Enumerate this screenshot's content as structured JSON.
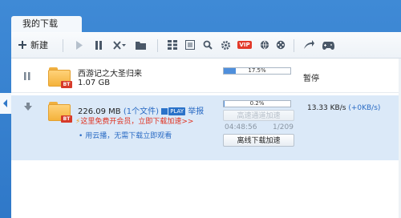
{
  "window": {
    "tab_title": "我的下载"
  },
  "toolbar": {
    "new_label": "新建",
    "vip_label": "VIP",
    "icons": [
      "plus-icon",
      "play-icon",
      "pause-icon",
      "delete-icon",
      "folder-icon",
      "list-view-icon",
      "details-icon",
      "search-icon",
      "gear-icon",
      "vip-icon",
      "globe-icon",
      "film-reel-icon",
      "share-icon",
      "gamepad-icon"
    ]
  },
  "colors": {
    "accent": "#2f78c8",
    "promo": "#e0301e",
    "link": "#2a6bc4",
    "progress": "#4f8fdc"
  },
  "tasks": [
    {
      "name": "西游记之大圣归来",
      "size": "1.07 GB",
      "badge": "BT",
      "progress_text": "17.5%",
      "progress": 0.175,
      "status": "暂停"
    },
    {
      "size": "226.09 MB",
      "file_count": "(1个文件)",
      "play": "PLAY",
      "report": "举报",
      "badge": "BT",
      "promo": "这里免费开会员，立即下载加速>>",
      "cloud": "用云播，无需下载立即观看",
      "progress_text": "0.2%",
      "progress": 0.002,
      "time_left": "04:48:56",
      "pieces": "1/209",
      "speed": "13.33  KB/s",
      "speed_bonus": "(+0KB/s)",
      "btn_high_speed": "高速通道加速",
      "btn_offline": "离线下载加速"
    }
  ]
}
